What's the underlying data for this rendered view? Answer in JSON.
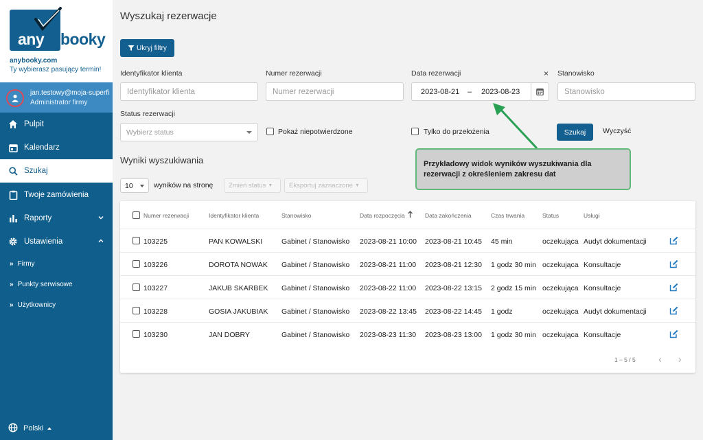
{
  "brand": {
    "logo_any": "any",
    "logo_booky": "booky",
    "url": "anybooky.com",
    "tagline": "Ty wybierasz pasujący termin!"
  },
  "user": {
    "email": "jan.testowy@moja-superfirma.pl",
    "role": "Administrator firmy"
  },
  "nav": {
    "items": [
      {
        "label": "Pulpit",
        "icon": "home-icon"
      },
      {
        "label": "Kalendarz",
        "icon": "calendar-icon"
      },
      {
        "label": "Szukaj",
        "icon": "search-icon"
      },
      {
        "label": "Twoje zamówienia",
        "icon": "clipboard-icon"
      },
      {
        "label": "Raporty",
        "icon": "bar-chart-icon"
      },
      {
        "label": "Ustawienia",
        "icon": "gear-icon"
      }
    ],
    "sub_items": [
      "Firmy",
      "Punkty serwisowe",
      "Użytkownicy"
    ],
    "language": "Polski"
  },
  "page": {
    "title": "Wyszukaj rezerwacje",
    "hide_filters_label": "Ukryj filtry"
  },
  "filters": {
    "client_id_label": "Identyfikator klienta",
    "client_id_placeholder": "Identyfikator klienta",
    "reservation_no_label": "Numer rezerwacji",
    "reservation_no_placeholder": "Numer rezerwacji",
    "date_label": "Data rezerwacji",
    "date_from": "2023-08-21",
    "date_separator": "–",
    "date_to": "2023-08-23",
    "station_label": "Stanowisko",
    "station_placeholder": "Stanowisko",
    "status_label": "Status rezerwacji",
    "status_placeholder": "Wybierz status",
    "unconfirmed_label": "Pokaż niepotwierdzone",
    "reschedule_label": "Tylko do przełożenia",
    "search_label": "Szukaj",
    "clear_label": "Wyczyść",
    "clear_date": "×"
  },
  "results": {
    "title": "Wyniki wyszukiwania",
    "per_page_value": "10",
    "per_page_label": "wyników na stronę",
    "change_status_label": "Zmień status",
    "export_label": "Eksportuj zaznaczone",
    "columns": [
      "Numer rezerwacji",
      "Identyfikator klienta",
      "Stanowisko",
      "Data rozpoczęcia",
      "Data zakończenia",
      "Czas trwania",
      "Status",
      "Usługi"
    ],
    "rows": [
      [
        "103225",
        "PAN KOWALSKI",
        "Gabinet / Stanowisko",
        "2023-08-21 10:00",
        "2023-08-21 10:45",
        "45 min",
        "oczekująca",
        "Audyt dokumentacji"
      ],
      [
        "103226",
        "DOROTA NOWAK",
        "Gabinet / Stanowisko",
        "2023-08-21 11:00",
        "2023-08-21 12:30",
        "1 godz 30 min",
        "oczekująca",
        "Konsultacje"
      ],
      [
        "103227",
        "JAKUB SKARBEK",
        "Gabinet / Stanowisko",
        "2023-08-22 11:00",
        "2023-08-22 13:15",
        "2 godz 15 min",
        "oczekująca",
        "Konsultacje"
      ],
      [
        "103228",
        "GOSIA JAKUBIAK",
        "Gabinet / Stanowisko",
        "2023-08-22 13:45",
        "2023-08-22 14:45",
        "1 godz",
        "oczekująca",
        "Audyt dokumentacji"
      ],
      [
        "103230",
        "JAN DOBRY",
        "Gabinet / Stanowisko",
        "2023-08-23 11:30",
        "2023-08-23 13:00",
        "1 godz 30 min",
        "oczekująca",
        "Konsultacje"
      ]
    ],
    "pagination": "1 – 5 / 5"
  },
  "annotation": {
    "text": "Przykładowy widok wyników wyszukiwania dla rezerwacji z określeniem zakresu dat"
  },
  "colors": {
    "primary": "#125f90",
    "sidebar": "#0f5e8c",
    "user_bar": "#3c8ac1",
    "callout_border": "#62b77a",
    "arrow": "#2aa055"
  }
}
